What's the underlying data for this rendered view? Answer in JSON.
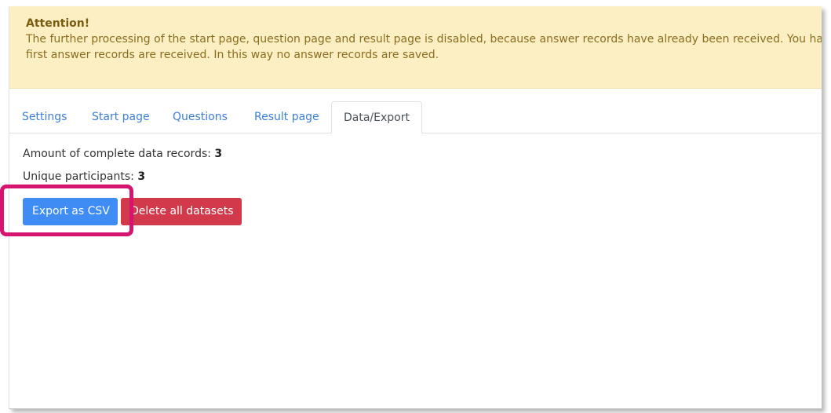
{
  "alert": {
    "title": "Attention!",
    "line1": "The further processing of the start page, question page and result page is disabled, because answer records have already been received. You ha",
    "line2": "first answer records are received. In this way no answer records are saved."
  },
  "tabs": [
    {
      "label": "Settings",
      "active": false
    },
    {
      "label": "Start page",
      "active": false
    },
    {
      "label": "Questions",
      "active": false
    },
    {
      "label": "Result page",
      "active": false
    },
    {
      "label": "Data/Export",
      "active": true
    }
  ],
  "stats": {
    "complete_label": "Amount of complete data records:",
    "complete_value": "3",
    "unique_label": "Unique participants:",
    "unique_value": "3"
  },
  "buttons": {
    "export_label": "Export as CSV",
    "delete_label": "Delete all datasets"
  },
  "colors": {
    "alert_bg": "#fcefc3",
    "link": "#3d7ed8",
    "primary": "#3f8cf4",
    "danger": "#d23a4c",
    "highlight": "#d6136e"
  }
}
